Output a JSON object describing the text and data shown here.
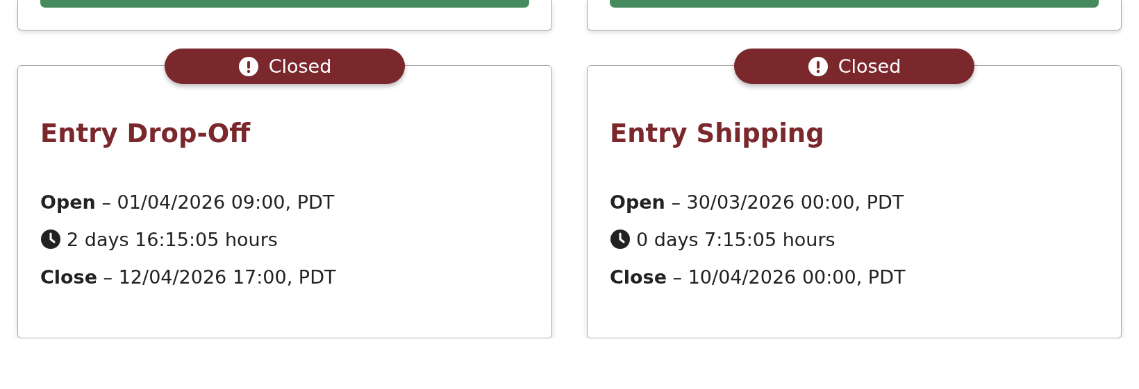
{
  "partial_cards": [
    {
      "kind": "button-card"
    },
    {
      "kind": "button-card"
    }
  ],
  "event_cards": [
    {
      "status": {
        "kind": "closed",
        "label": "Closed"
      },
      "title": "Entry Drop-Off",
      "open": "**Open** – 01/04/2026 09:00, PDT",
      "countdown": "2 days 16:15:05 hours",
      "close": "**Close** – 12/04/2026 17:00, PDT"
    },
    {
      "status": {
        "kind": "closed",
        "label": "Closed"
      },
      "title": "Entry Shipping",
      "open": "**Open** – 30/03/2026 00:00, PDT",
      "countdown": "0 days 7:15:05 hours",
      "close": "**Close** – 10/04/2026 00:00, PDT"
    }
  ]
}
